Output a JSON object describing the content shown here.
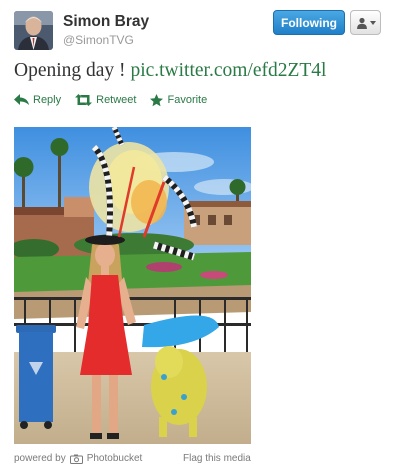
{
  "user": {
    "name": "Simon Bray",
    "handle": "@SimonTVG",
    "avatar_icon": "avatar-photo"
  },
  "header": {
    "follow_label": "Following",
    "user_menu_icon": "user-dropdown-icon"
  },
  "tweet": {
    "text": "Opening day ! ",
    "link": "pic.twitter.com/efd2ZT4l"
  },
  "actions": [
    {
      "label": "Reply",
      "icon": "reply-icon"
    },
    {
      "label": "Retweet",
      "icon": "retweet-icon"
    },
    {
      "label": "Favorite",
      "icon": "star-icon"
    }
  ],
  "footer": {
    "powered_prefix": "powered by",
    "powered_brand": "Photobucket",
    "flag_label": "Flag this media"
  },
  "colors": {
    "link_green": "#2a7a46",
    "follow_blue": "#2f92d6",
    "muted_text": "#999999"
  }
}
